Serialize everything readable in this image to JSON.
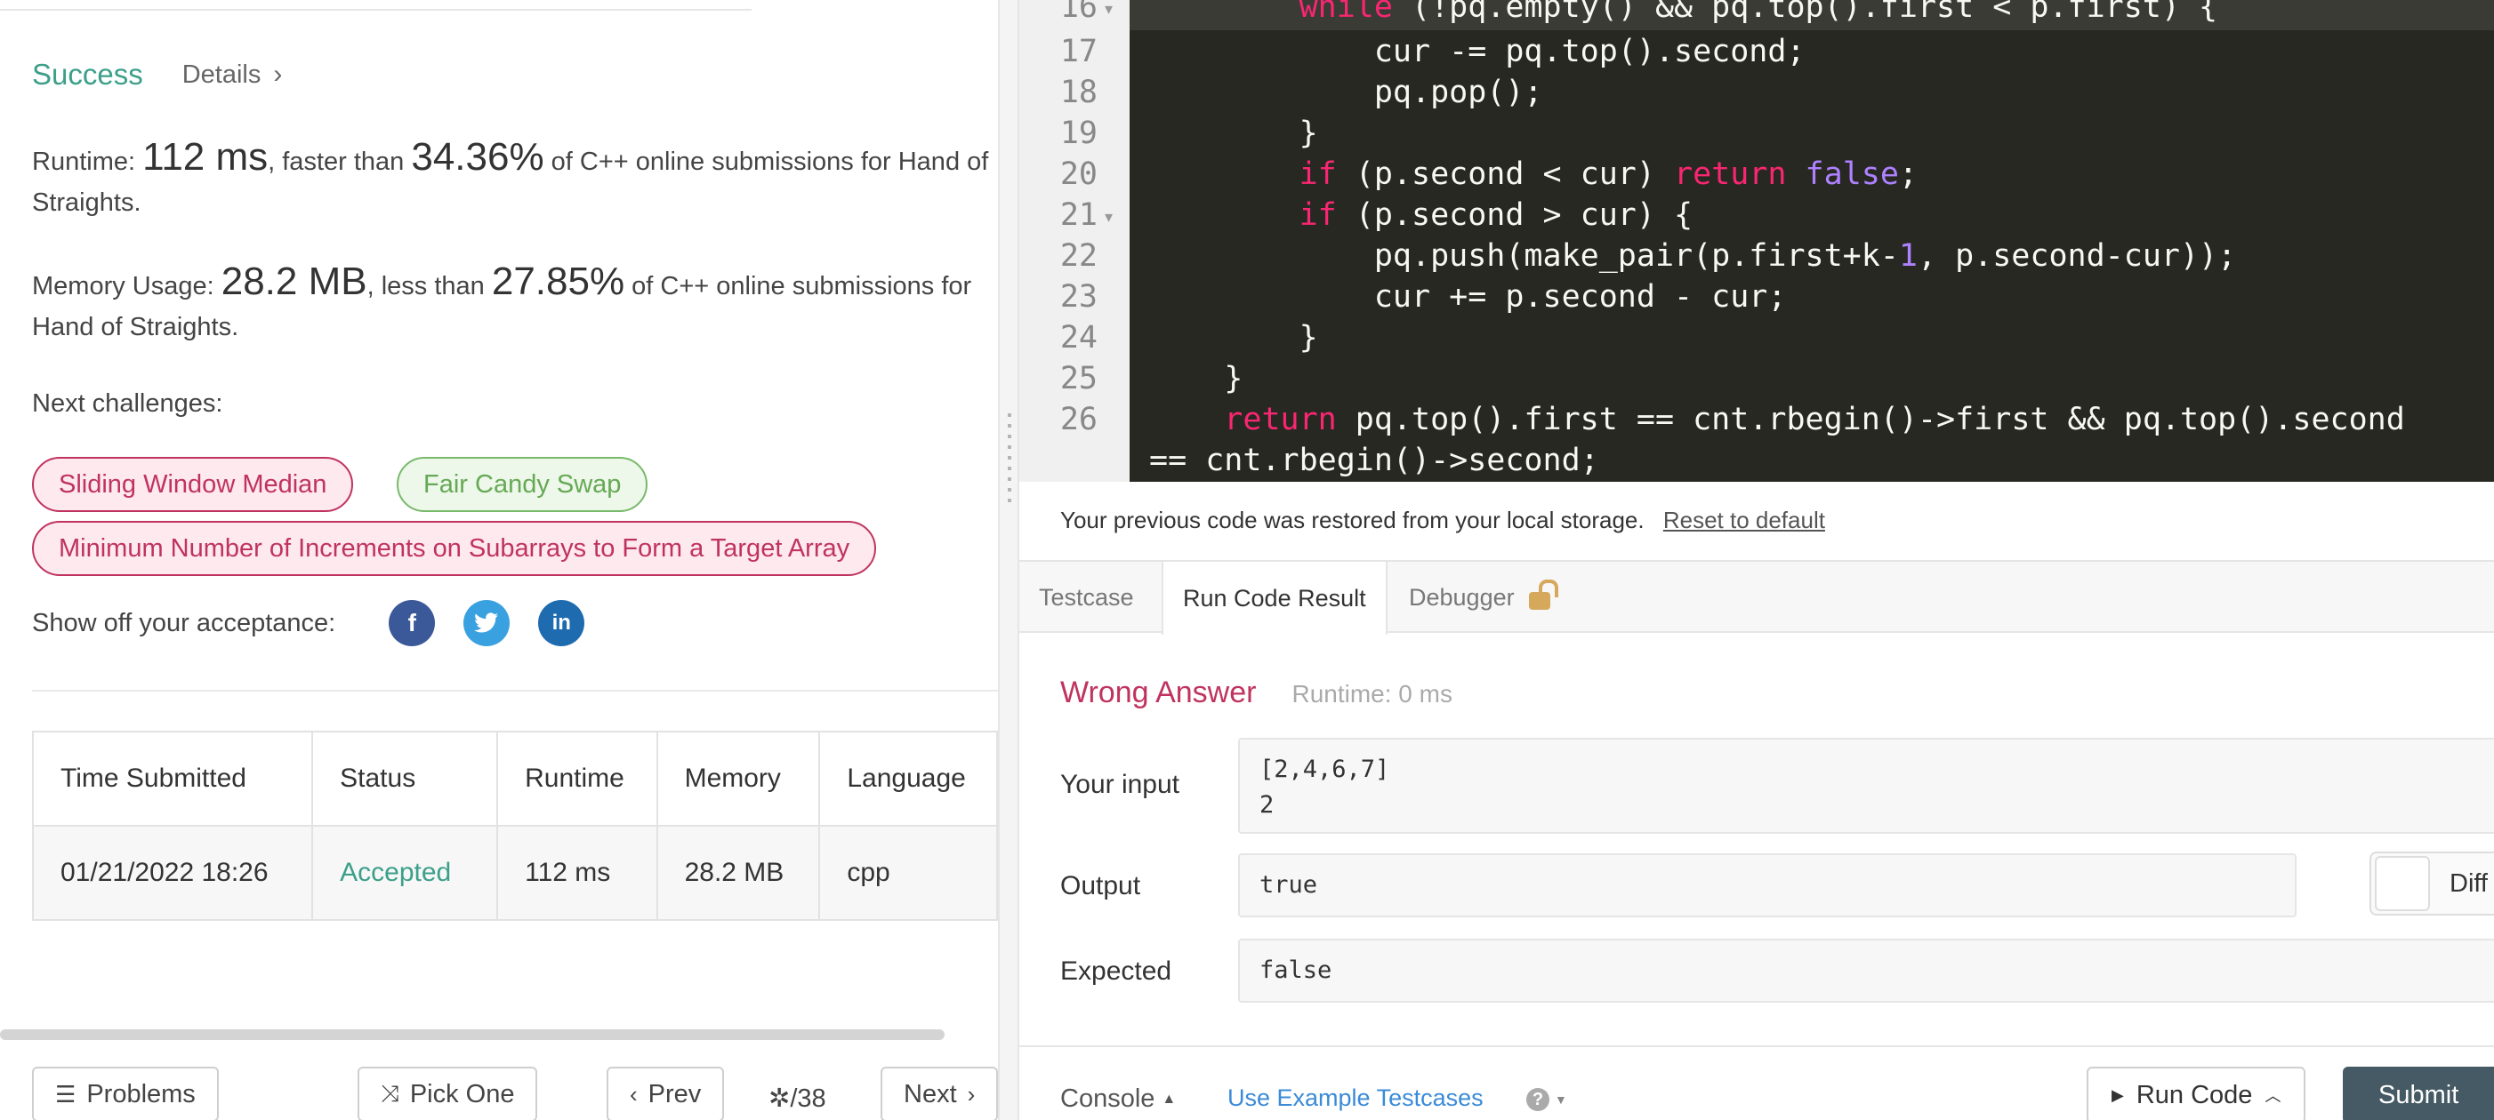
{
  "submission": {
    "status": "Success",
    "details_label": "Details",
    "runtime_label": "Runtime:",
    "runtime_value": "112 ms",
    "runtime_faster": ", faster than",
    "runtime_pct": "34.36%",
    "runtime_tail": "of C++ online submissions for Hand of Straights.",
    "memory_label": "Memory Usage:",
    "memory_value": "28.2 MB",
    "memory_less": ", less than",
    "memory_pct": "27.85%",
    "memory_tail": "of C++ online submissions for Hand of Straights."
  },
  "next_challenges": {
    "label": "Next challenges:",
    "items": [
      {
        "label": "Sliding Window Median",
        "difficulty": "hard"
      },
      {
        "label": "Fair Candy Swap",
        "difficulty": "easy"
      },
      {
        "label": "Minimum Number of Increments on Subarrays to Form a Target Array",
        "difficulty": "hard"
      }
    ]
  },
  "share": {
    "label": "Show off your acceptance:",
    "icons": [
      "facebook-icon",
      "twitter-icon",
      "linkedin-icon"
    ]
  },
  "table": {
    "headers": [
      "Time Submitted",
      "Status",
      "Runtime",
      "Memory",
      "Language"
    ],
    "rows": [
      [
        "01/21/2022 18:26",
        "Accepted",
        "112 ms",
        "28.2 MB",
        "cpp"
      ]
    ]
  },
  "left_footer": {
    "problems": "Problems",
    "pick_one": "Pick One",
    "prev": "Prev",
    "page": "/38",
    "next": "Next"
  },
  "editor": {
    "lines": [
      {
        "n": "16",
        "fold": true
      },
      {
        "n": "17",
        "fold": false
      },
      {
        "n": "18",
        "fold": false
      },
      {
        "n": "19",
        "fold": false
      },
      {
        "n": "20",
        "fold": false
      },
      {
        "n": "21",
        "fold": true
      },
      {
        "n": "22",
        "fold": false
      },
      {
        "n": "23",
        "fold": false
      },
      {
        "n": "24",
        "fold": false
      },
      {
        "n": "25",
        "fold": false
      },
      {
        "n": "26",
        "fold": false
      }
    ]
  },
  "storage": {
    "message": "Your previous code was restored from your local storage.",
    "reset": "Reset to default"
  },
  "tabs": [
    "Testcase",
    "Run Code Result",
    "Debugger"
  ],
  "result": {
    "verdict": "Wrong Answer",
    "runtime": "Runtime: 0 ms",
    "input_label": "Your input",
    "input_value": "[2,4,6,7]\n2",
    "output_label": "Output",
    "output_value": "true",
    "expected_label": "Expected",
    "expected_value": "false",
    "diff_label": "Diff"
  },
  "right_footer": {
    "console": "Console",
    "use_example": "Use Example Testcases",
    "run_code": "Run Code",
    "submit": "Submit"
  },
  "colors": {
    "success": "#3c9f8a",
    "wrong": "#c0335f",
    "link": "#3a8bd8",
    "editor_bg": "#272822",
    "submit_bg": "#455a64"
  }
}
